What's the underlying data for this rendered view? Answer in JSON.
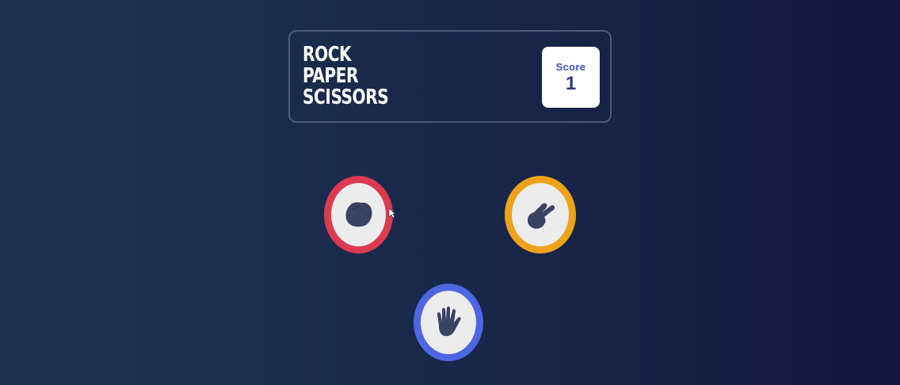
{
  "game": {
    "title_lines": [
      "ROCK",
      "PAPER",
      "SCISSORS"
    ],
    "score_label": "Score",
    "score_value": "1"
  },
  "choices": [
    {
      "name": "rock",
      "icon": "rock-hand-icon",
      "ring_color": "#dd3a52"
    },
    {
      "name": "scissors",
      "icon": "scissors-hand-icon",
      "ring_color": "#eca318"
    },
    {
      "name": "paper",
      "icon": "paper-hand-icon",
      "ring_color": "#4d67e3"
    }
  ],
  "colors": {
    "background": "#192a4c",
    "icon": "#3a4262",
    "score_label": "#3a55b9"
  }
}
